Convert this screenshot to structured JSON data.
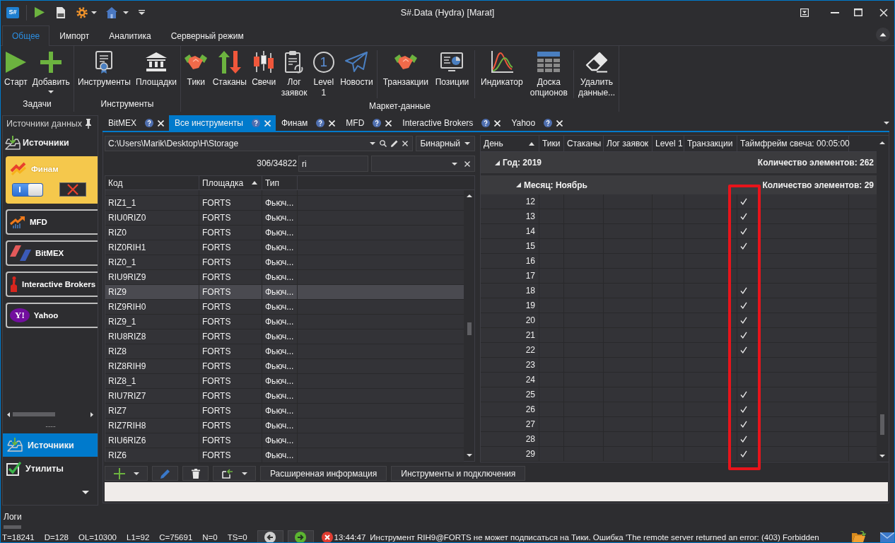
{
  "window": {
    "logo": "S#",
    "title": "S#.Data (Hydra) [Marat]"
  },
  "ribbon": {
    "tabs": [
      {
        "label": "Общее",
        "selected": true
      },
      {
        "label": "Импорт",
        "selected": false
      },
      {
        "label": "Аналитика",
        "selected": false
      },
      {
        "label": "Серверный режим",
        "selected": false
      }
    ],
    "groups": [
      {
        "label": "Задачи",
        "sections": [
          {
            "buttons": [
              {
                "label": "Старт"
              },
              {
                "label": "Добавить",
                "dropdown": true
              }
            ]
          }
        ]
      },
      {
        "label": "Инструменты",
        "sections": [
          {
            "buttons": [
              {
                "label": "Инструменты"
              },
              {
                "label": "Площадки"
              }
            ]
          }
        ]
      },
      {
        "label": "Маркет-данные",
        "sections": [
          {
            "buttons": [
              {
                "label": "Тики"
              },
              {
                "label": "Стаканы"
              },
              {
                "label": "Свечи"
              },
              {
                "label": "Лог заявок"
              },
              {
                "label": "Level 1",
                "icon_text": "1"
              },
              {
                "label": "Новости"
              }
            ]
          },
          {
            "buttons": [
              {
                "label": "Транзакции"
              },
              {
                "label": "Позиции"
              }
            ]
          },
          {
            "buttons": [
              {
                "label": "Индикатор"
              },
              {
                "label": "Доска опционов"
              }
            ]
          },
          {
            "buttons": [
              {
                "label": "Удалить данные..."
              }
            ]
          }
        ]
      }
    ]
  },
  "sources_panel": {
    "title": "Источники данных",
    "heading": "Источники",
    "sources": [
      {
        "name": "Финам",
        "selected": true,
        "enabled": true
      },
      {
        "name": "MFD",
        "selected": false
      },
      {
        "name": "BitMEX",
        "selected": false
      },
      {
        "name": "Interactive Brokers",
        "selected": false
      },
      {
        "name": "Yahoo",
        "selected": false,
        "logo_text": "Y!"
      }
    ],
    "nav": [
      {
        "label": "Источники",
        "selected": true
      },
      {
        "label": "Утилиты",
        "selected": false
      }
    ]
  },
  "document_tabs": [
    {
      "label": "BitMEX",
      "selected": false
    },
    {
      "label": "Все инструменты",
      "selected": true
    },
    {
      "label": "Финам",
      "selected": false
    },
    {
      "label": "MFD",
      "selected": false
    },
    {
      "label": "Interactive Brokers",
      "selected": false
    },
    {
      "label": "Yahoo",
      "selected": false
    }
  ],
  "storage": {
    "path": "C:\\Users\\Marik\\Desktop\\H\\Storage",
    "format": "Бинарный"
  },
  "filter": {
    "count": "306/34822",
    "value": "ri"
  },
  "instruments": {
    "columns": [
      {
        "label": "Код"
      },
      {
        "label": "Площадка",
        "sorted": true
      },
      {
        "label": "Тип"
      }
    ],
    "rows": [
      {
        "cells": [
          "RIZ1_1",
          "FORTS",
          "Фьюч..."
        ],
        "selected": false
      },
      {
        "cells": [
          "RIU0RIZ0",
          "FORTS",
          "Фьюч..."
        ],
        "selected": false
      },
      {
        "cells": [
          "RIZ0",
          "FORTS",
          "Фьюч..."
        ],
        "selected": false
      },
      {
        "cells": [
          "RIZ0RIH1",
          "FORTS",
          "Фьюч..."
        ],
        "selected": false
      },
      {
        "cells": [
          "RIZ0_1",
          "FORTS",
          "Фьюч..."
        ],
        "selected": false
      },
      {
        "cells": [
          "RIU9RIZ9",
          "FORTS",
          "Фьюч..."
        ],
        "selected": false
      },
      {
        "cells": [
          "RIZ9",
          "FORTS",
          "Фьюч..."
        ],
        "selected": true
      },
      {
        "cells": [
          "RIZ9RIH0",
          "FORTS",
          "Фьюч..."
        ],
        "selected": false
      },
      {
        "cells": [
          "RIZ9_1",
          "FORTS",
          "Фьюч..."
        ],
        "selected": false
      },
      {
        "cells": [
          "RIU8RIZ8",
          "FORTS",
          "Фьюч..."
        ],
        "selected": false
      },
      {
        "cells": [
          "RIZ8",
          "FORTS",
          "Фьюч..."
        ],
        "selected": false
      },
      {
        "cells": [
          "RIZ8RIH9",
          "FORTS",
          "Фьюч..."
        ],
        "selected": false
      },
      {
        "cells": [
          "RIZ8_1",
          "FORTS",
          "Фьюч..."
        ],
        "selected": false
      },
      {
        "cells": [
          "RIU7RIZ7",
          "FORTS",
          "Фьюч..."
        ],
        "selected": false
      },
      {
        "cells": [
          "RIZ7",
          "FORTS",
          "Фьюч..."
        ],
        "selected": false
      },
      {
        "cells": [
          "RIZ7RIH8",
          "FORTS",
          "Фьюч..."
        ],
        "selected": false
      },
      {
        "cells": [
          "RIU6RIZ6",
          "FORTS",
          "Фьюч..."
        ],
        "selected": false
      },
      {
        "cells": [
          "RIZ6",
          "FORTS",
          "Фьюч..."
        ],
        "selected": false
      }
    ]
  },
  "storage_grid": {
    "columns": [
      {
        "label": "День",
        "sorted": true
      },
      {
        "label": "Тики"
      },
      {
        "label": "Стаканы"
      },
      {
        "label": "Лог заявок"
      },
      {
        "label": "Level 1"
      },
      {
        "label": "Транзакции"
      },
      {
        "label": "Таймфрейм свеча: 00:05:00",
        "highlighted": true
      }
    ],
    "groups": [
      {
        "label": "Год: 2019",
        "count": "Количество элементов: 262",
        "expanded": true,
        "children": [
          {
            "label": "Месяц: Ноябрь",
            "count": "Количество элементов: 29",
            "expanded": true,
            "rows": [
              {
                "day": "12",
                "checks": [
                  false,
                  false,
                  false,
                  false,
                  false,
                  true
                ]
              },
              {
                "day": "13",
                "checks": [
                  false,
                  false,
                  false,
                  false,
                  false,
                  true
                ]
              },
              {
                "day": "14",
                "checks": [
                  false,
                  false,
                  false,
                  false,
                  false,
                  true
                ]
              },
              {
                "day": "15",
                "checks": [
                  false,
                  false,
                  false,
                  false,
                  false,
                  true
                ]
              },
              {
                "day": "16",
                "checks": [
                  false,
                  false,
                  false,
                  false,
                  false,
                  false
                ]
              },
              {
                "day": "17",
                "checks": [
                  false,
                  false,
                  false,
                  false,
                  false,
                  false
                ]
              },
              {
                "day": "18",
                "checks": [
                  false,
                  false,
                  false,
                  false,
                  false,
                  true
                ]
              },
              {
                "day": "19",
                "checks": [
                  false,
                  false,
                  false,
                  false,
                  false,
                  true
                ]
              },
              {
                "day": "20",
                "checks": [
                  false,
                  false,
                  false,
                  false,
                  false,
                  true
                ]
              },
              {
                "day": "21",
                "checks": [
                  false,
                  false,
                  false,
                  false,
                  false,
                  true
                ]
              },
              {
                "day": "22",
                "checks": [
                  false,
                  false,
                  false,
                  false,
                  false,
                  true
                ]
              },
              {
                "day": "23",
                "checks": [
                  false,
                  false,
                  false,
                  false,
                  false,
                  false
                ]
              },
              {
                "day": "24",
                "checks": [
                  false,
                  false,
                  false,
                  false,
                  false,
                  false
                ]
              },
              {
                "day": "25",
                "checks": [
                  false,
                  false,
                  false,
                  false,
                  false,
                  true
                ]
              },
              {
                "day": "26",
                "checks": [
                  false,
                  false,
                  false,
                  false,
                  false,
                  true
                ]
              },
              {
                "day": "27",
                "checks": [
                  false,
                  false,
                  false,
                  false,
                  false,
                  true
                ]
              },
              {
                "day": "28",
                "checks": [
                  false,
                  false,
                  false,
                  false,
                  false,
                  true
                ]
              },
              {
                "day": "29",
                "checks": [
                  false,
                  false,
                  false,
                  false,
                  false,
                  true
                ]
              }
            ]
          }
        ]
      }
    ]
  },
  "toolbar": {
    "buttons": [
      {
        "label": "Расширенная информация"
      },
      {
        "label": "Инструменты и подключения"
      }
    ]
  },
  "logs": {
    "label": "Логи"
  },
  "status_bar": {
    "counters": [
      "T=18241",
      "D=128",
      "OL=10300",
      "L1=92",
      "C=75691",
      "N=0",
      "TS=0"
    ],
    "message": {
      "kind": "error",
      "time": "13:44:47",
      "text": "Инструмент RIH9@FORTS не может подписаться на Тики. Ошибка 'The remote server returned an error: (403) Forbidden"
    }
  }
}
